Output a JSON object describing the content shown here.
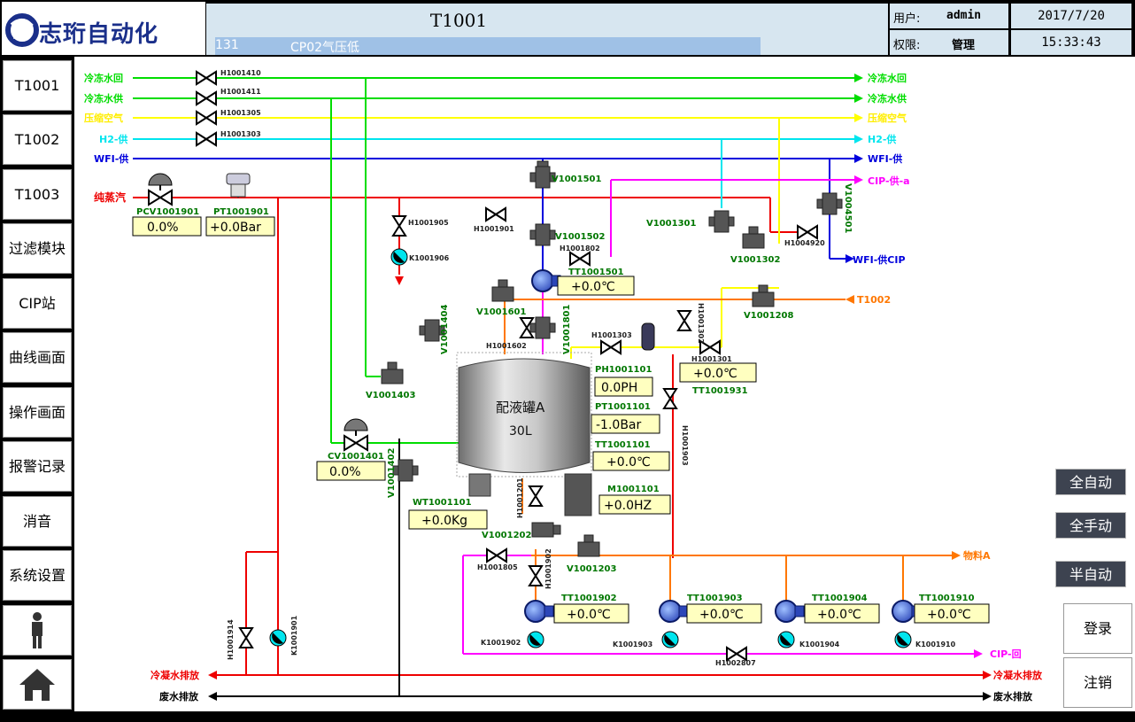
{
  "header": {
    "logo_text": "志珩自动化",
    "title": "T1001",
    "alarm": {
      "code": "131",
      "message": "CP02气压低"
    },
    "user_label": "用户:",
    "user_value": "admin",
    "role_label": "权限:",
    "role_value": "管理",
    "date": "2017/7/20",
    "time": "15:33:43"
  },
  "nav": [
    {
      "label": "T1001"
    },
    {
      "label": "T1002"
    },
    {
      "label": "T1003"
    },
    {
      "label": "过滤模块"
    },
    {
      "label": "CIP站"
    },
    {
      "label": "曲线画面"
    },
    {
      "label": "操作画面"
    },
    {
      "label": "报警记录"
    },
    {
      "label": "消音"
    },
    {
      "label": "系统设置"
    }
  ],
  "mode_buttons": {
    "auto": "全自动",
    "manual": "全手动",
    "semi": "半自动"
  },
  "action_buttons": {
    "login": "登录",
    "logout": "注销"
  },
  "colors": {
    "green": "#00dd00",
    "yellow": "#ffff00",
    "cyan": "#00e5ee",
    "blue": "#0000dd",
    "red": "#ee0000",
    "magenta": "#ff00ff",
    "orange": "#ff7700",
    "black": "#000000"
  },
  "lines": {
    "chw_return": "冷冻水回",
    "chw_supply": "冷冻水供",
    "comp_air": "压缩空气",
    "h2_supply": "H2-供",
    "wfi_supply": "WFI-供",
    "pure_steam": "纯蒸汽",
    "cip_supply_a": "CIP-供-a",
    "wfi_cip": "WFI-供CIP",
    "t1002": "T1002",
    "material_a": "物料A",
    "cip_return": "CIP-回",
    "cond_drain": "冷凝水排放",
    "waste_drain": "废水排放"
  },
  "tank": {
    "name": "配液罐A",
    "volume": "30L"
  },
  "tags": {
    "H1001410": "H1001410",
    "H1001411": "H1001411",
    "H1001305a": "H1001305",
    "H1001303a": "H1001303",
    "PCV1001901": "PCV1001901",
    "PT1001901": "PT1001901",
    "H1001905": "H1001905",
    "K1001906": "K1001906",
    "H1001901": "H1001901",
    "V1001501": "V1001501",
    "V1001502": "V1001502",
    "H1001802": "H1001802",
    "TT1001501": "TT1001501",
    "V1001301": "V1001301",
    "V1001302": "V1001302",
    "H1004920": "H1004920",
    "V1004501": "V1004501",
    "V1001208": "V1001208",
    "V1001601": "V1001601",
    "H1001602": "H1001602",
    "V1001801": "V1001801",
    "V1001404": "V1001404",
    "V1001403": "V1001403",
    "H1001303b": "H1001303",
    "H1001302": "H1001302",
    "H1001301": "H1001301",
    "TT1001931": "TT1001931",
    "PH1001101": "PH1001101",
    "PT1001101": "PT1001101",
    "TT1001101": "TT1001101",
    "M1001101": "M1001101",
    "H1001903": "H1001903",
    "CV1001401": "CV1001401",
    "V1001402": "V1001402",
    "WT1001101": "WT1001101",
    "H1001201": "H1001201",
    "V1001202": "V1001202",
    "H1001805": "H1001805",
    "V1001203": "V1001203",
    "H1001902": "H1001902",
    "TT1001902": "TT1001902",
    "K1001902": "K1001902",
    "TT1001903": "TT1001903",
    "K1001903": "K1001903",
    "H1002807": "H1002807",
    "TT1001904": "TT1001904",
    "K1001904": "K1001904",
    "TT1001910": "TT1001910",
    "K1001910": "K1001910",
    "H1001914": "H1001914",
    "K1001901": "K1001901"
  },
  "readings": {
    "PCV1001901": "0.0%",
    "PT1001901": "+0.0Bar",
    "TT1001501": "+0.0℃",
    "TT1001931": "+0.0℃",
    "PH1001101": "0.0PH",
    "PT1001101": "-1.0Bar",
    "TT1001101": "+0.0℃",
    "M1001101": "+0.0HZ",
    "CV1001401": "0.0%",
    "WT1001101": "+0.0Kg",
    "TT1001902": "+0.0℃",
    "TT1001903": "+0.0℃",
    "TT1001904": "+0.0℃",
    "TT1001910": "+0.0℃"
  }
}
